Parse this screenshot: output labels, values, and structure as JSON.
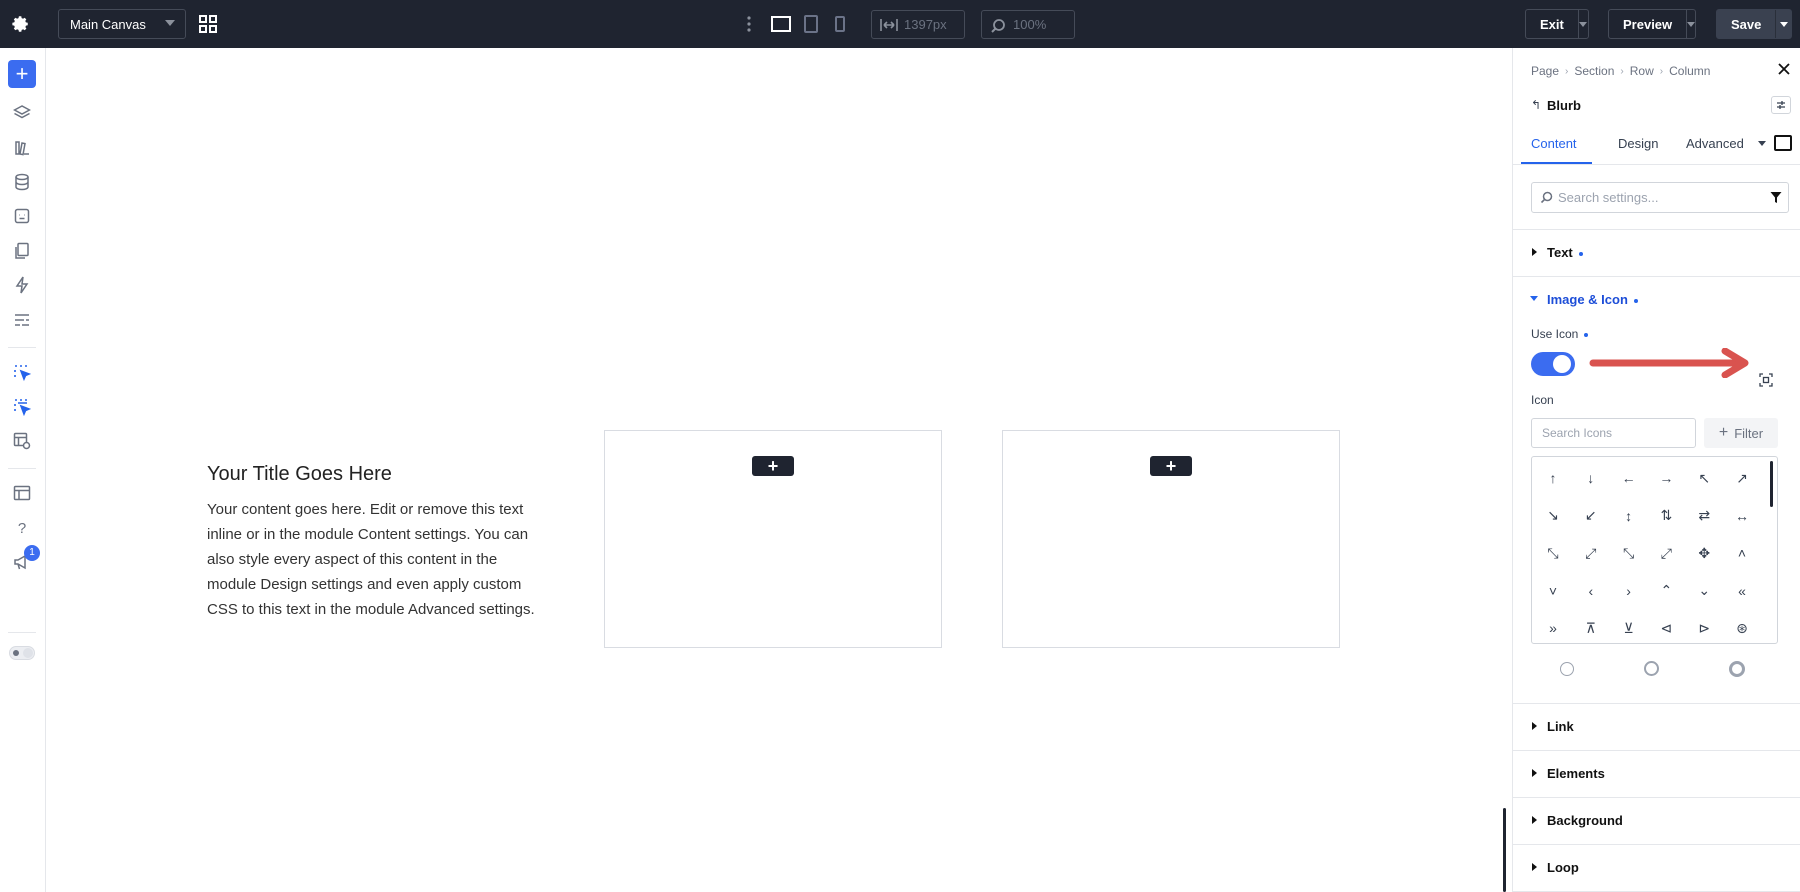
{
  "topbar": {
    "canvas_name": "Main Canvas",
    "width_value": "1397px",
    "zoom_value": "100%",
    "exit_label": "Exit",
    "preview_label": "Preview",
    "save_label": "Save"
  },
  "sidebar": {
    "notification_count": "1"
  },
  "canvas": {
    "blurb_title": "Your Title Goes Here",
    "blurb_body": "Your content goes here. Edit or remove this text inline or in the module Content settings. You can also style every aspect of this content in the module Design settings and even apply custom CSS to this text in the module Advanced settings."
  },
  "panel": {
    "breadcrumb": [
      "Page",
      "Section",
      "Row",
      "Column"
    ],
    "module_name": "Blurb",
    "tabs": {
      "content": "Content",
      "design": "Design",
      "advanced": "Advanced"
    },
    "search_placeholder": "Search settings...",
    "groups": {
      "text": "Text",
      "image_icon": "Image & Icon",
      "link": "Link",
      "elements": "Elements",
      "background": "Background",
      "loop": "Loop"
    },
    "use_icon_label": "Use Icon",
    "use_icon_enabled": true,
    "icon_label": "Icon",
    "icon_search_placeholder": "Search Icons",
    "icon_filter_label": "Filter",
    "icons": [
      "↑",
      "↓",
      "←",
      "→",
      "↖",
      "↗",
      "↘",
      "↙",
      "↕",
      "⇅",
      "⇄",
      "↔",
      "⤡",
      "⤢",
      "⤡",
      "⤢",
      "✥",
      "˄",
      "˅",
      "‹",
      "›",
      "⌃",
      "⌄",
      "«",
      "»",
      "⊼",
      "⊻",
      "⊲",
      "⊳",
      "⊛"
    ],
    "accent_color": "#3b6cf0",
    "annotation_color": "#d9534f"
  }
}
